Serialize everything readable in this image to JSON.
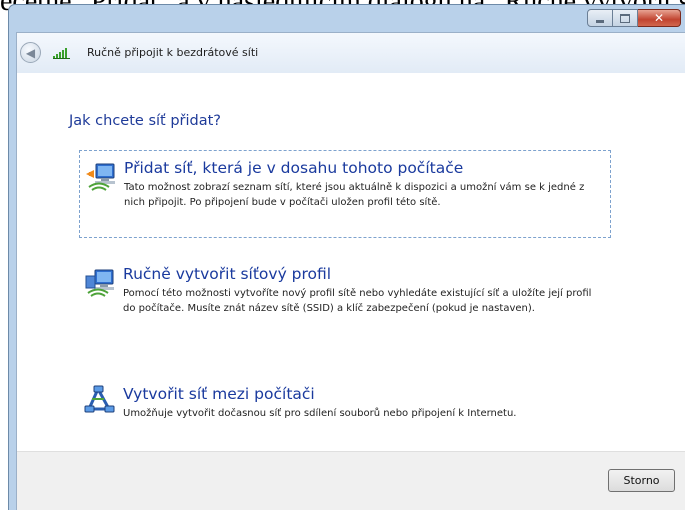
{
  "document_caption": "ečetně „Přidat“ a v následujícím dialogu na „Ručně vytvořit síťový profil“",
  "window": {
    "title": "Ručně připojit k bezdrátové síti",
    "caption_buttons": {
      "minimize": "minimize-icon",
      "maximize": "maximize-icon",
      "close": "close-icon"
    }
  },
  "question": "Jak chcete síť přidat?",
  "options": [
    {
      "title": "Přidat síť, která je v dosahu tohoto počítače",
      "access_key": "a",
      "description": "Tato možnost zobrazí seznam sítí, které jsou aktuálně k dispozici a umožní vám se k jedné z nich připojit. Po připojení bude v počítači uložen profil této sítě.",
      "icon": "network-add-icon"
    },
    {
      "title": "Ručně vytvořit síťový profil",
      "access_key": "R",
      "description": "Pomocí této možnosti vytvoříte nový profil sítě nebo vyhledáte existující síť a uložíte její profil do počítače. Musíte znát název sítě (SSID) a klíč zabezpečení (pokud je nastaven).",
      "icon": "network-profile-icon"
    },
    {
      "title": "Vytvořit síť mezi počítači",
      "access_key": "V",
      "description": "Umožňuje vytvořit dočasnou síť pro sdílení souborů nebo připojení k Internetu.",
      "icon": "adhoc-network-icon"
    }
  ],
  "footer": {
    "cancel_label": "Storno"
  },
  "colors": {
    "link_blue": "#1a3a9e",
    "question_blue": "#1f3b99",
    "frame": "#b9d1ea"
  }
}
